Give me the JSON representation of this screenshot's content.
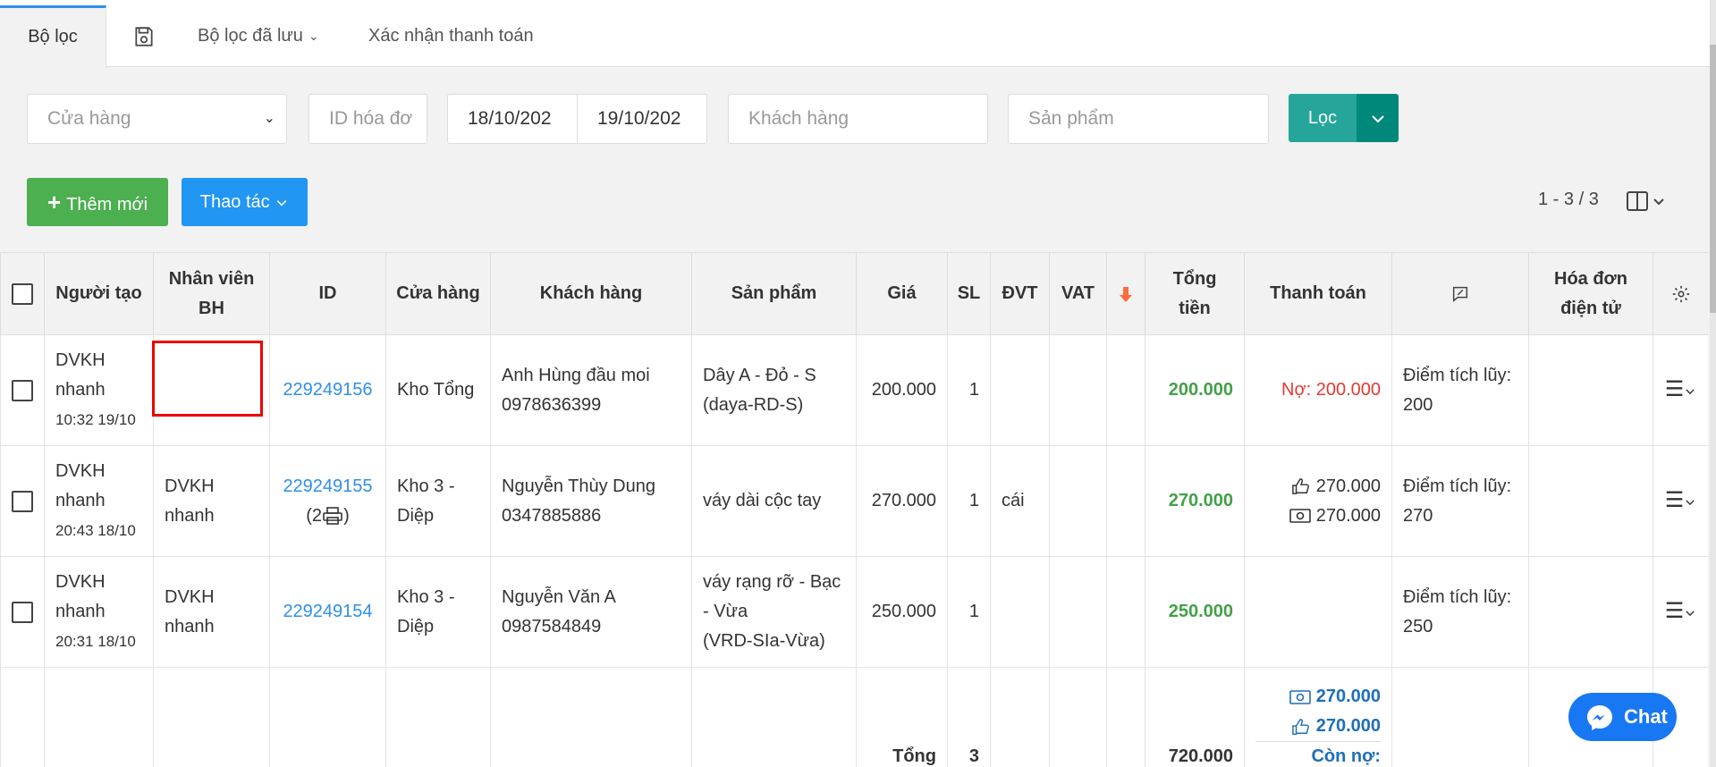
{
  "tabs": {
    "filter": "Bộ lọc",
    "saved_filters": "Bộ lọc đã lưu",
    "confirm_payment": "Xác nhận thanh toán"
  },
  "filters": {
    "store_placeholder": "Cửa hàng",
    "invoice_id_placeholder": "ID hóa đơ",
    "date_from": "18/10/202",
    "date_to": "19/10/202",
    "customer_placeholder": "Khách hàng",
    "product_placeholder": "Sản phẩm",
    "filter_button": "Lọc"
  },
  "actions": {
    "add_new": "Thêm mới",
    "operations": "Thao tác"
  },
  "pager": "1 - 3 / 3",
  "table": {
    "headers": {
      "creator": "Người tạo",
      "sales_staff_1": "Nhân viên",
      "sales_staff_2": "BH",
      "id": "ID",
      "store": "Cửa hàng",
      "customer": "Khách hàng",
      "product": "Sản phẩm",
      "price": "Giá",
      "qty": "SL",
      "unit": "ĐVT",
      "vat": "VAT",
      "total_1": "Tổng",
      "total_2": "tiền",
      "payment": "Thanh toán",
      "einvoice_1": "Hóa đơn",
      "einvoice_2": "điện tử"
    },
    "rows": [
      {
        "creator_1": "DVKH",
        "creator_2": "nhanh",
        "time": "10:32 19/10",
        "staff_1": "",
        "staff_2": "",
        "id": "229249156",
        "print_count": "",
        "store_1": "Kho Tổng",
        "store_2": "",
        "customer_name": "Anh Hùng đầu moi",
        "customer_phone": "0978636399",
        "product_1": "Dây A - Đỏ - S",
        "product_2": "(daya-RD-S)",
        "product_3": "",
        "price": "200.000",
        "qty": "1",
        "unit": "",
        "vat": "",
        "total": "200.000",
        "payment_1": "Nợ: 200.000",
        "payment_2": "",
        "points_1": "Điểm tích lũy:",
        "points_2": "200"
      },
      {
        "creator_1": "DVKH",
        "creator_2": "nhanh",
        "time": "20:43 18/10",
        "staff_1": "DVKH",
        "staff_2": "nhanh",
        "id": "229249155",
        "print_count": "(2",
        "store_1": "Kho 3 -",
        "store_2": "Diệp",
        "customer_name": "Nguyễn Thùy Dung",
        "customer_phone": "0347885886",
        "product_1": "váy dài cộc tay",
        "product_2": "",
        "product_3": "",
        "price": "270.000",
        "qty": "1",
        "unit": "cái",
        "vat": "",
        "total": "270.000",
        "payment_1": "270.000",
        "payment_2": "270.000",
        "points_1": "Điểm tích lũy:",
        "points_2": "270"
      },
      {
        "creator_1": "DVKH",
        "creator_2": "nhanh",
        "time": "20:31 18/10",
        "staff_1": "DVKH",
        "staff_2": "nhanh",
        "id": "229249154",
        "print_count": "",
        "store_1": "Kho 3 -",
        "store_2": "Diệp",
        "customer_name": "Nguyễn Văn A",
        "customer_phone": "0987584849",
        "product_1": "váy rạng rỡ - Bạc",
        "product_2": "- Vừa",
        "product_3": "(VRD-SIa-Vừa)",
        "price": "250.000",
        "qty": "1",
        "unit": "",
        "vat": "",
        "total": "250.000",
        "payment_1": "",
        "payment_2": "",
        "points_1": "Điểm tích lũy:",
        "points_2": "250"
      }
    ],
    "totals": {
      "label": "Tổng",
      "qty": "3",
      "total": "720.000",
      "cash": "270.000",
      "transfer": "270.000",
      "remaining_debt": "Còn nợ:"
    }
  },
  "chat": "Chat",
  "colors": {
    "accent_blue": "#2196f3",
    "add_green": "#4caf50",
    "filter_teal": "#26a69a",
    "total_green": "#43a047",
    "debt_red": "#e53935",
    "chat_blue": "#1877f2"
  },
  "icons": [
    "save-icon",
    "plus-icon",
    "columns-icon",
    "sort-arrow-icon",
    "note-icon",
    "gear-icon",
    "menu-icon",
    "printer-icon",
    "thumbs-up-icon",
    "cash-icon",
    "messenger-icon"
  ]
}
